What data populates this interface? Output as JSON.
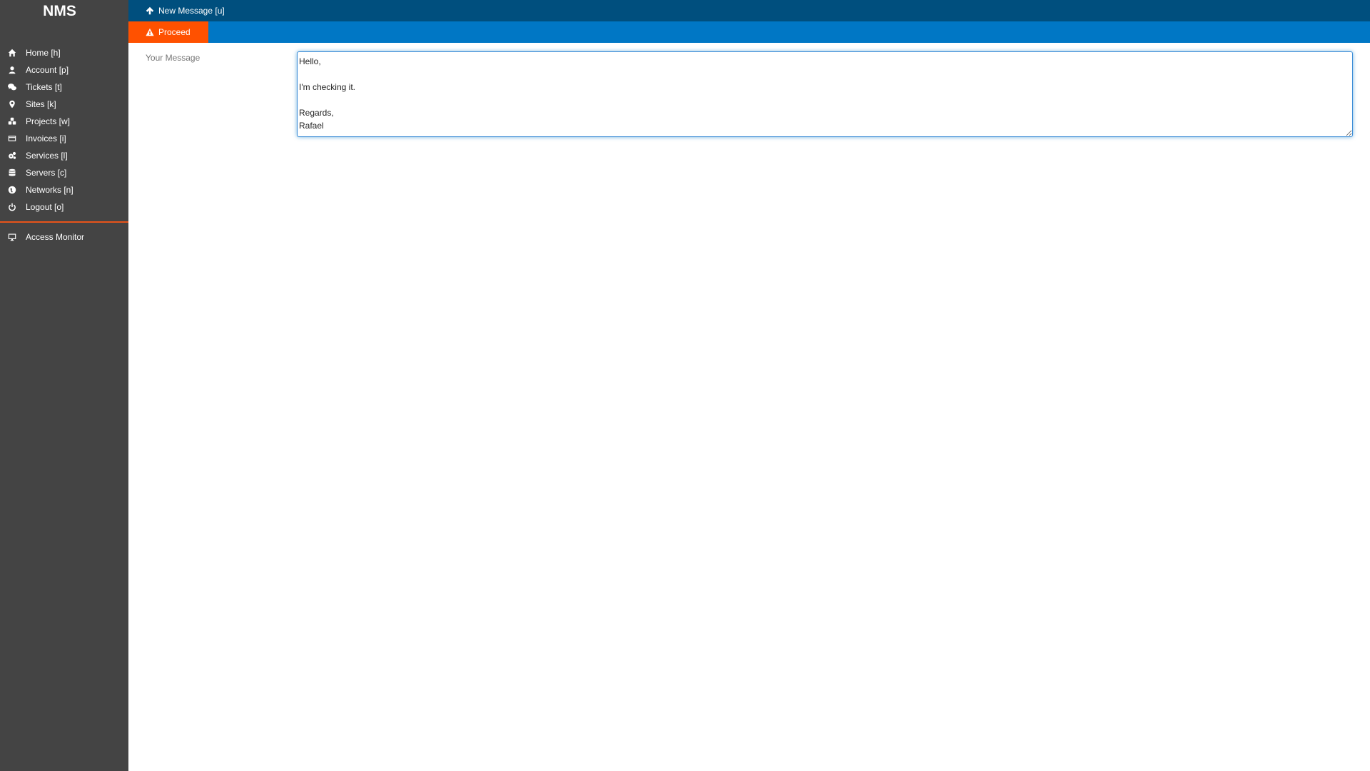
{
  "sidebar": {
    "brand": "NMS",
    "items": [
      {
        "label": "Home [h]",
        "icon": "home-icon"
      },
      {
        "label": "Account [p]",
        "icon": "user-icon"
      },
      {
        "label": "Tickets [t]",
        "icon": "comments-icon"
      },
      {
        "label": "Sites [k]",
        "icon": "map-marker-icon"
      },
      {
        "label": "Projects [w]",
        "icon": "cubes-icon"
      },
      {
        "label": "Invoices [i]",
        "icon": "credit-card-icon"
      },
      {
        "label": "Services [l]",
        "icon": "cogs-icon"
      },
      {
        "label": "Servers [c]",
        "icon": "database-icon"
      },
      {
        "label": "Networks [n]",
        "icon": "globe-icon"
      },
      {
        "label": "Logout [o]",
        "icon": "power-icon"
      }
    ],
    "extra_items": [
      {
        "label": "Access Monitor",
        "icon": "desktop-icon"
      }
    ]
  },
  "topbar": {
    "new_message_label": "New Message [u]"
  },
  "actionbar": {
    "proceed_label": "Proceed"
  },
  "form": {
    "message_label": "Your Message",
    "message_value": "Hello,\n\nI'm checking it.\n\nRegards,\nRafael"
  },
  "colors": {
    "sidebar_bg": "#444444",
    "topbar_bg": "#004f7e",
    "actionbar_bg": "#0077c5",
    "accent": "#ff5100"
  }
}
